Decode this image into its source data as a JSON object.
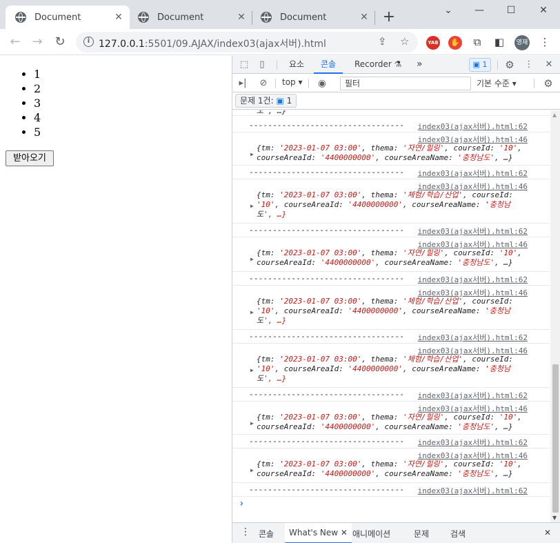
{
  "browser": {
    "tabs": [
      {
        "title": "Document",
        "active": true
      },
      {
        "title": "Document",
        "active": false
      },
      {
        "title": "Document",
        "active": false
      }
    ],
    "url_host": "127.0.0.1",
    "url_rest": ":5501/09.AJAX/index03(ajax서버).html",
    "profile_initials": "영재",
    "extension_label": "YAB"
  },
  "page": {
    "list_items": [
      "1",
      "2",
      "3",
      "4",
      "5"
    ],
    "fetch_button_label": "받아오기"
  },
  "devtools": {
    "tabs": [
      "요소",
      "콘솔",
      "Recorder"
    ],
    "active_tab": "콘솔",
    "message_count": "1",
    "context": "top",
    "filter_placeholder": "필터",
    "log_level": "기본 수준",
    "issues_label": "문제 1건:",
    "issues_count": "1",
    "console": {
      "top_fragment": "도', …}",
      "separator": "---------------------------------",
      "link_62": "index03(ajax서버).html:62",
      "link_46": "index03(ajax서버).html:46",
      "obj_a_line1": "{tm: '2023-01-07 03:00', thema: '자연/힐링', courseId: '10',",
      "obj_a_line2": "courseAreaId: '4400000000', courseAreaName: '충청남도', …}",
      "obj_b_line1": "{tm: '2023-01-07 03:00', thema: '체험/학습/산업', courseId:",
      "obj_b_line2": "'10', courseAreaId: '4400000000', courseAreaName: '충청남",
      "obj_b_line3": "도', …}"
    },
    "drawer_tabs": [
      "콘솔",
      "What's New",
      "애니메이션",
      "문제",
      "검색"
    ]
  }
}
